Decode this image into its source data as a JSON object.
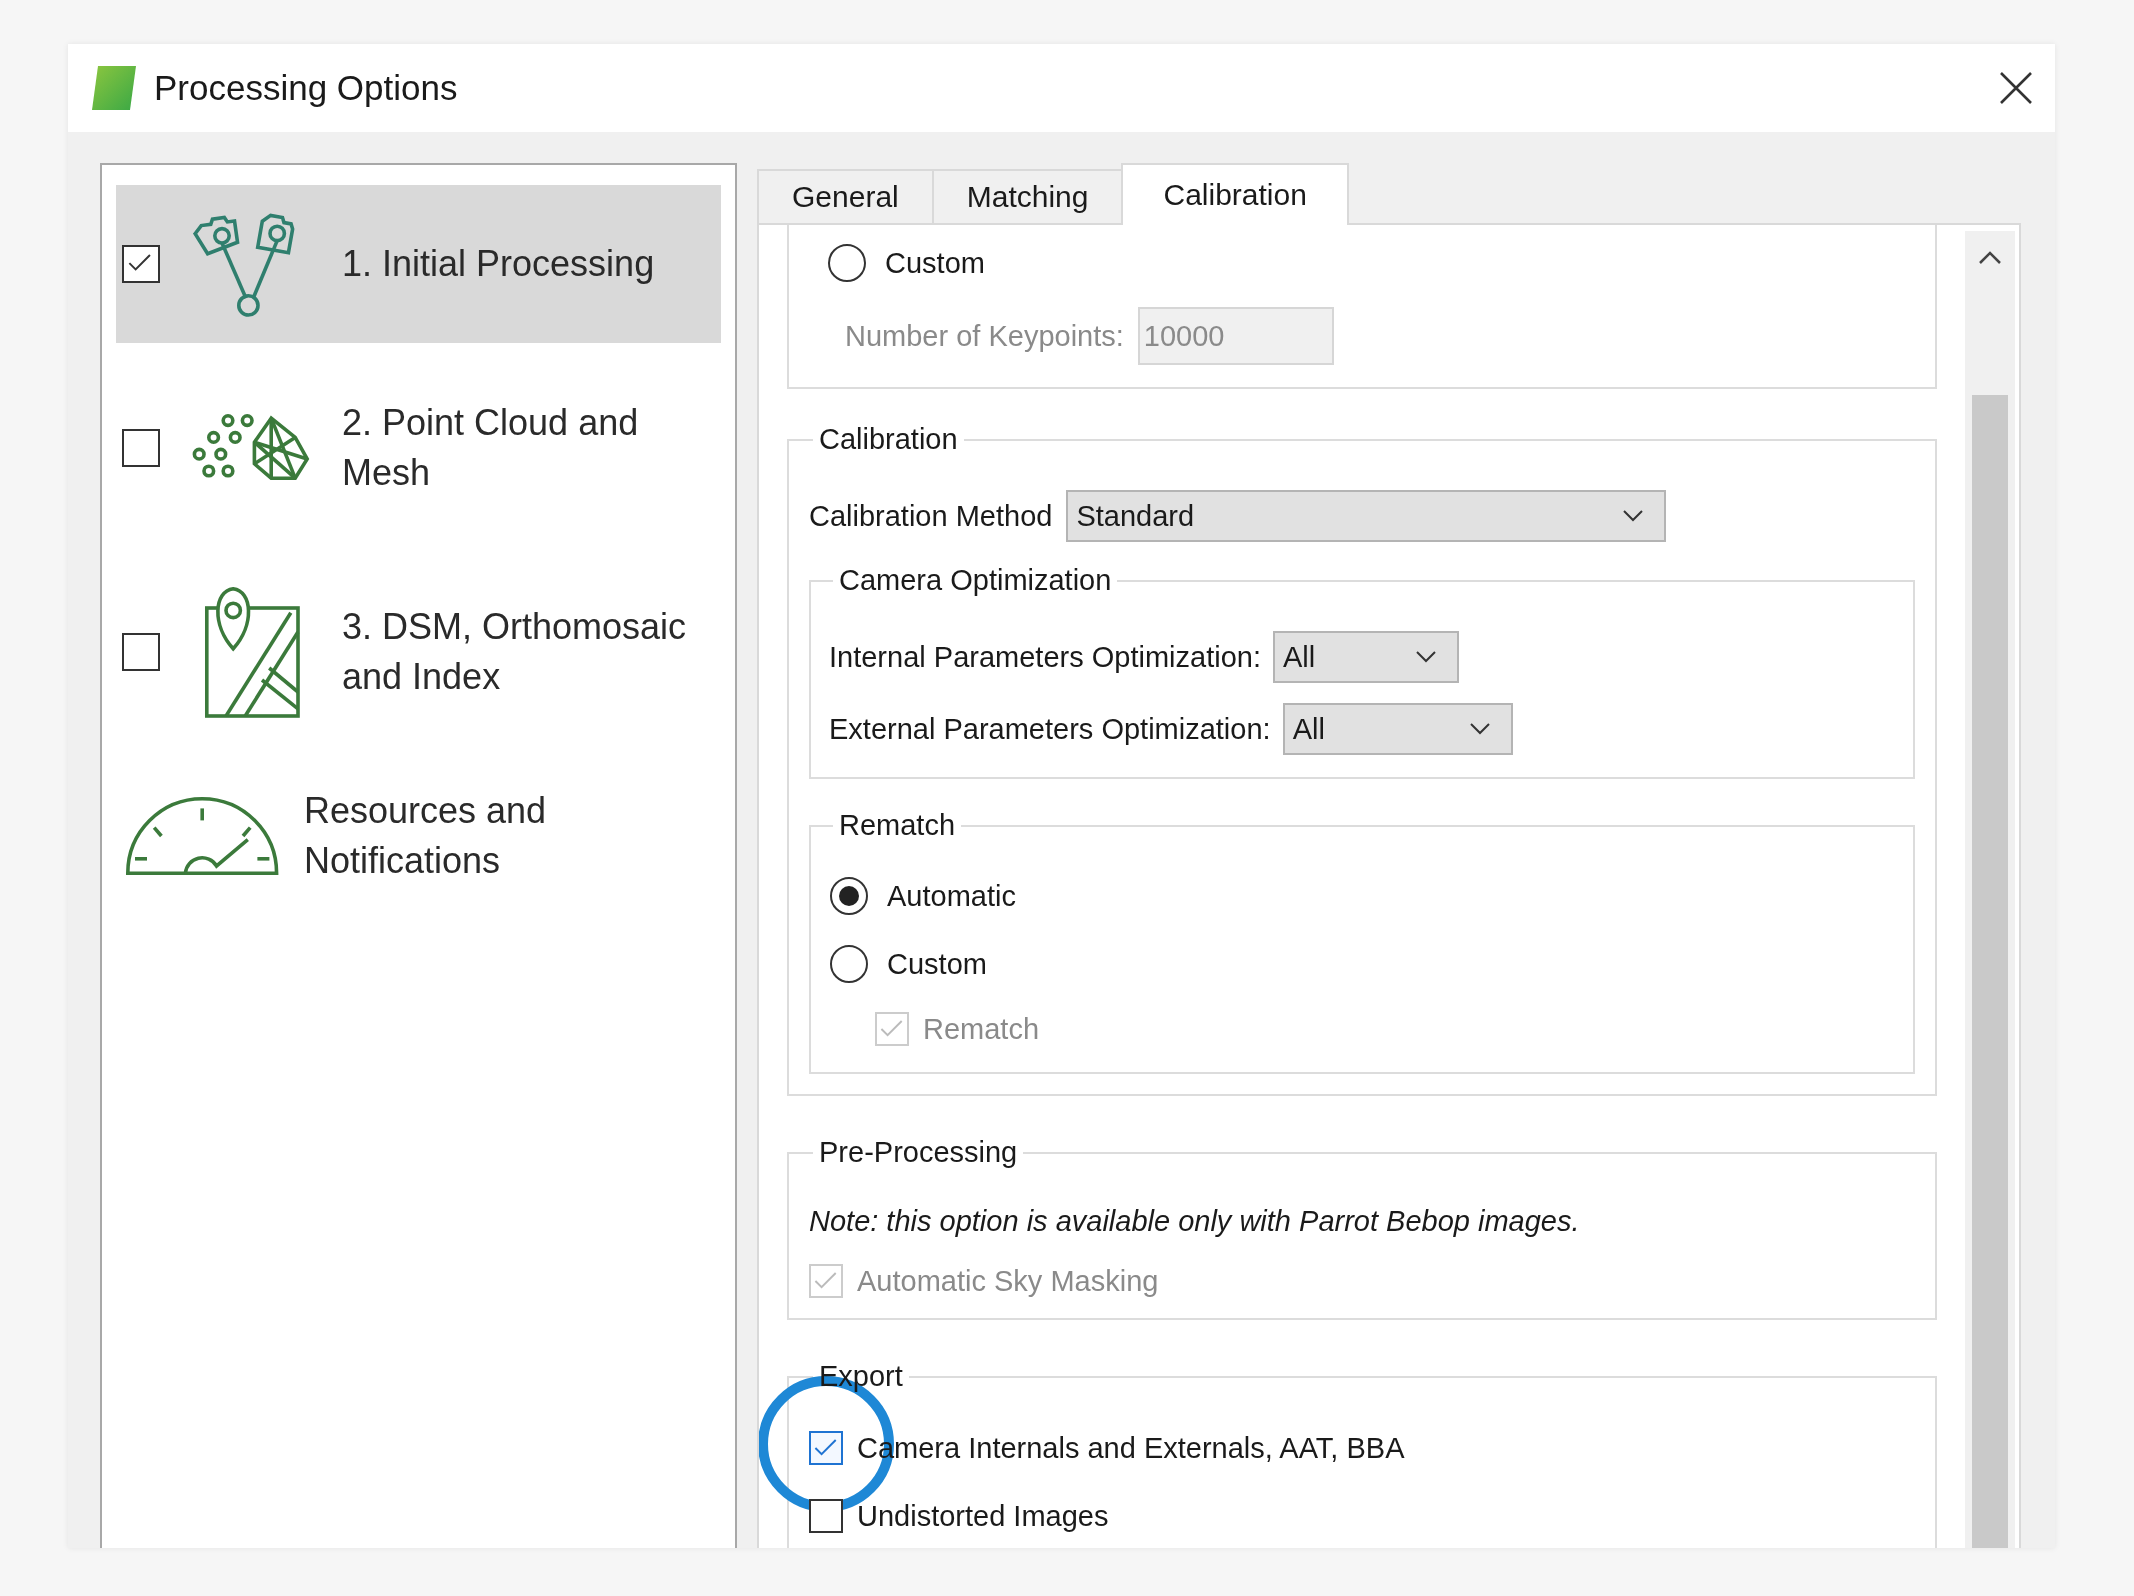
{
  "window": {
    "title": "Processing Options"
  },
  "sidebar": {
    "items": [
      {
        "label": "1. Initial Processing",
        "kind": "cameras",
        "checked": true,
        "selected": true
      },
      {
        "label": "2. Point Cloud and Mesh",
        "kind": "mesh",
        "checked": false,
        "selected": false
      },
      {
        "label": "3. DSM, Orthomosaic and Index",
        "kind": "map",
        "checked": false,
        "selected": false
      },
      {
        "label": "Resources and Notifications",
        "kind": "gauge",
        "selected": false
      }
    ]
  },
  "tabs": [
    {
      "label": "General",
      "selected": false
    },
    {
      "label": "Matching",
      "selected": false
    },
    {
      "label": "Calibration",
      "selected": true
    }
  ],
  "keypoints_section": {
    "radio": {
      "label": "Custom",
      "selected": false
    },
    "field": {
      "label": "Number of Keypoints:",
      "value": "10000",
      "disabled": true
    }
  },
  "calibration": {
    "title": "Calibration",
    "method": {
      "label": "Calibration Method",
      "value": "Standard"
    },
    "camera_optimization": {
      "title": "Camera Optimization",
      "rows": [
        {
          "label": "Internal Parameters Optimization:",
          "value": "All"
        },
        {
          "label": "External Parameters Optimization:",
          "value": "All"
        }
      ]
    },
    "rematch": {
      "title": "Rematch",
      "options": [
        {
          "label": "Automatic",
          "selected": true
        },
        {
          "label": "Custom",
          "selected": false
        }
      ],
      "checkbox": {
        "label": "Rematch",
        "checked": true,
        "disabled": true
      }
    }
  },
  "pre_processing": {
    "title": "Pre-Processing",
    "note": "Note: this option is available only with Parrot Bebop images.",
    "checkbox": {
      "label": "Automatic Sky Masking",
      "checked": true,
      "disabled": true
    }
  },
  "export": {
    "title": "Export",
    "checkboxes": [
      {
        "label": "Camera Internals and Externals, AAT, BBA",
        "checked": true,
        "highlighted": true
      },
      {
        "label": "Undistorted Images",
        "checked": false,
        "highlighted": false
      }
    ]
  }
}
